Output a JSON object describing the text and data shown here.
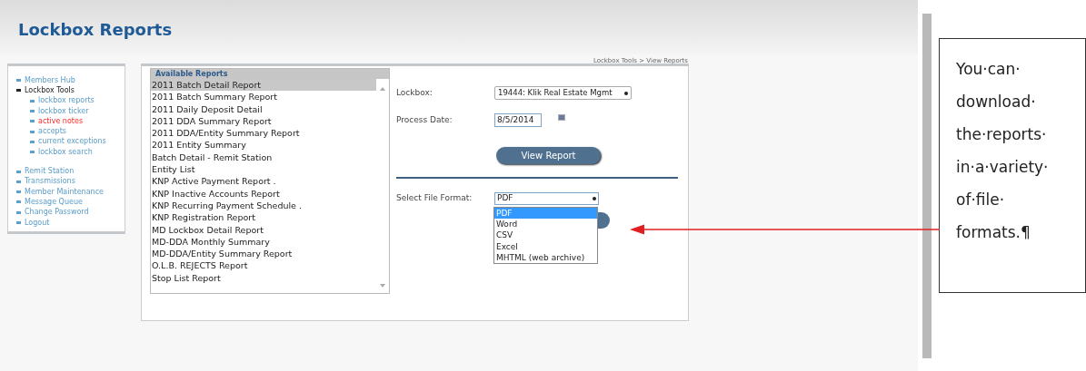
{
  "page": {
    "title": "Lockbox Reports",
    "breadcrumb": "Lockbox Tools > View Reports"
  },
  "sidebar": {
    "items": [
      {
        "label": "Members Hub",
        "selected": false
      },
      {
        "label": "Lockbox Tools",
        "selected": false,
        "expanded": true,
        "children": [
          {
            "label": "lockbox reports",
            "selected": false
          },
          {
            "label": "lockbox ticker",
            "selected": false
          },
          {
            "label": "active notes",
            "selected": true
          },
          {
            "label": "accepts",
            "selected": false
          },
          {
            "label": "current exceptions",
            "selected": false
          },
          {
            "label": "lockbox search",
            "selected": false
          }
        ]
      },
      {
        "label": "Remit Station",
        "selected": false
      },
      {
        "label": "Transmissions",
        "selected": false
      },
      {
        "label": "Member Maintenance",
        "selected": false
      },
      {
        "label": "Message Queue",
        "selected": false
      },
      {
        "label": "Change Password",
        "selected": false
      },
      {
        "label": "Logout",
        "selected": false
      }
    ]
  },
  "reports": {
    "heading": "Available Reports",
    "items": [
      {
        "label": "2011 Batch Detail Report",
        "selected": true
      },
      {
        "label": "2011 Batch Summary Report",
        "selected": false
      },
      {
        "label": "2011 Daily Deposit Detail",
        "selected": false
      },
      {
        "label": "2011 DDA Summary Report",
        "selected": false
      },
      {
        "label": "2011 DDA/Entity Summary Report",
        "selected": false
      },
      {
        "label": "2011 Entity Summary",
        "selected": false
      },
      {
        "label": "Batch Detail - Remit Station",
        "selected": false
      },
      {
        "label": "Entity List",
        "selected": false
      },
      {
        "label": "KNP Active Payment Report .",
        "selected": false
      },
      {
        "label": "KNP Inactive Accounts Report",
        "selected": false
      },
      {
        "label": "KNP Recurring Payment Schedule .",
        "selected": false
      },
      {
        "label": "KNP Registration Report",
        "selected": false
      },
      {
        "label": "MD Lockbox Detail Report",
        "selected": false
      },
      {
        "label": "MD-DDA Monthly Summary",
        "selected": false
      },
      {
        "label": "MD-DDA/Entity Summary Report",
        "selected": false
      },
      {
        "label": "O.L.B. REJECTS Report",
        "selected": false
      },
      {
        "label": "Stop List Report",
        "selected": false
      }
    ]
  },
  "form": {
    "lockbox": {
      "label": "Lockbox:",
      "value": "19444: Klik Real Estate Mgmt"
    },
    "process_date": {
      "label": "Process Date:",
      "value": "8/5/2014"
    },
    "view_button": "View Report",
    "file_format": {
      "label": "Select File Format:",
      "value": "PDF",
      "options": [
        {
          "label": "PDF",
          "selected": true
        },
        {
          "label": "Word",
          "selected": false
        },
        {
          "label": "CSV",
          "selected": false
        },
        {
          "label": "Excel",
          "selected": false
        },
        {
          "label": "MHTML (web archive)",
          "selected": false
        }
      ]
    }
  },
  "callout": {
    "text": "You·can·download·the·reports·in·a·variety·of·file·formats.¶"
  }
}
